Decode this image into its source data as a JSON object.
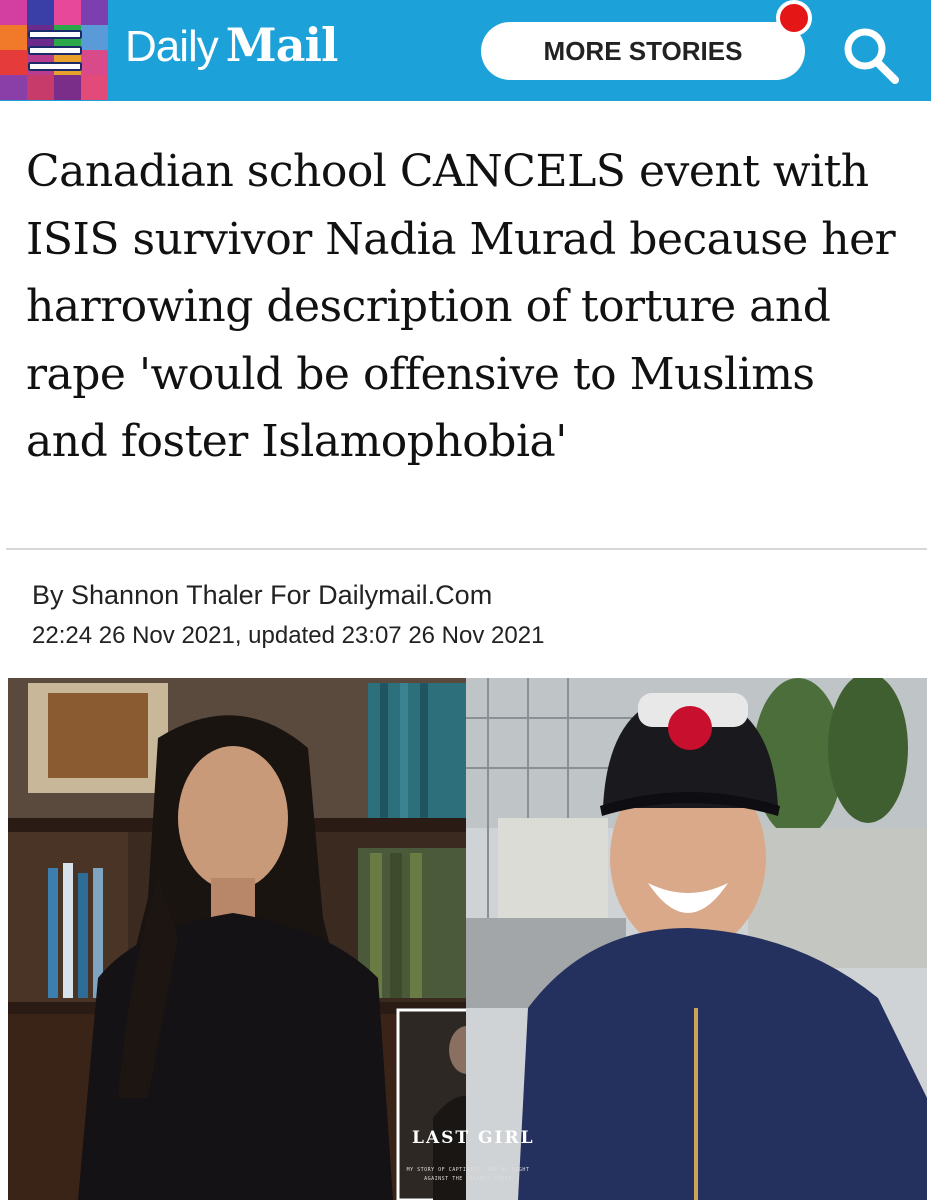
{
  "header": {
    "logo_daily": "Daily",
    "logo_mail": "Mail",
    "more_stories_label": "MORE STORIES",
    "brand_color": "#1da1d9",
    "notification_color": "#e51616",
    "icons": [
      "menu-icon",
      "search-icon"
    ]
  },
  "article": {
    "headline": "Canadian school CANCELS event with ISIS survivor Nadia Murad because her harrowing description of torture and rape 'would be offensive to Muslims and foster Islamophobia'",
    "byline": "By Shannon Thaler For Dailymail.Com",
    "dateline": "22:24 26 Nov 2021, updated 23:07 26 Nov 2021"
  },
  "photo": {
    "book_title": "LAST GIRL",
    "book_subtitle": "MY STORY OF CAPTIVITY, AND MY FIGHT AGAINST THE ISLAMIC STATE"
  }
}
